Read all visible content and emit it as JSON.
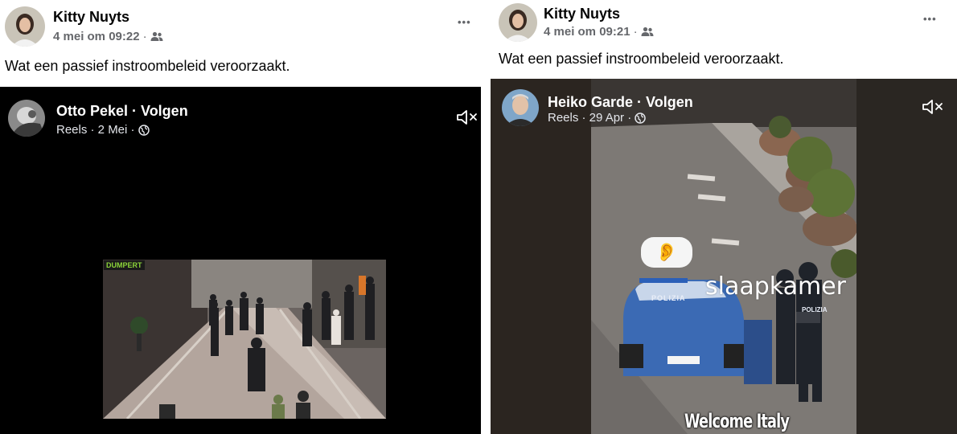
{
  "left_post": {
    "author": "Kitty Nuyts",
    "timestamp": "4 mei om 09:22",
    "separator": "·",
    "audience_icon": "friends-icon",
    "more_label": "•••",
    "caption": "Wat een passief instroombeleid veroorzaakt.",
    "reel": {
      "name_line": "Otto Pekel · Volgen",
      "meta": "Reels · 2 Mei ·",
      "privacy_icon": "globe-icon",
      "sound_icon": "muted-speaker-icon",
      "watermark": "DUMPERT"
    }
  },
  "right_post": {
    "author": "Kitty Nuyts",
    "timestamp": "4 mei om 09:21",
    "separator": "·",
    "audience_icon": "friends-icon",
    "more_label": "•••",
    "caption": "Wat een passief instroombeleid veroorzaakt.",
    "reel": {
      "name_line": "Heiko Garde · Volgen",
      "meta": "Reels · 29 Apr ·",
      "privacy_icon": "globe-icon",
      "sound_icon": "muted-speaker-icon",
      "overlay_word": "slaapkamer",
      "ear_emoji": "👂",
      "car_text_left": "POLIZIA",
      "officer_text": "POLIZIA",
      "subtitle": "Welcome Italy"
    }
  },
  "colors": {
    "text_primary": "#050505",
    "text_secondary": "#65676b",
    "video_bg": "#000000",
    "reel_meta": "#e4e6eb"
  }
}
